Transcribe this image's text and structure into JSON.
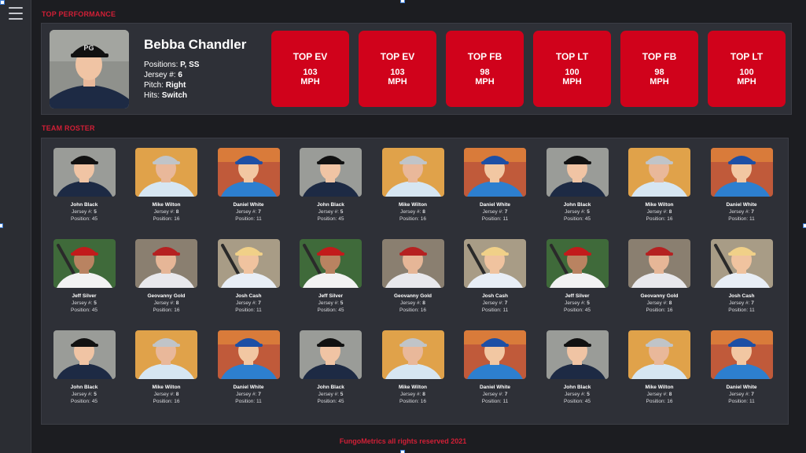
{
  "app": {
    "top_performance_label": "TOP PERFORMANCE",
    "team_roster_label": "TEAM ROSTER",
    "footer_text": "FungoMetrics all rights reserved 2021",
    "accent_color": "#d0021b",
    "menu_icon": "hamburger-menu-icon"
  },
  "profile": {
    "name": "Bebba Chandler",
    "positions_label": "Positions:",
    "positions": "P, SS",
    "jersey_label": "Jersey #:",
    "jersey": "6",
    "pitch_label": "Pitch:",
    "pitch": "Right",
    "hits_label": "Hits:",
    "hits": "Switch"
  },
  "stats": [
    {
      "label": "TOP EV",
      "value": "103",
      "unit": "MPH"
    },
    {
      "label": "TOP EV",
      "value": "103",
      "unit": "MPH"
    },
    {
      "label": "TOP FB",
      "value": "98",
      "unit": "MPH"
    },
    {
      "label": "TOP LT",
      "value": "100",
      "unit": "MPH"
    },
    {
      "label": "TOP FB",
      "value": "98",
      "unit": "MPH"
    },
    {
      "label": "TOP LT",
      "value": "100",
      "unit": "MPH"
    }
  ],
  "roster": [
    [
      {
        "name": "John Black",
        "jersey": "5",
        "position": "45",
        "avatar": "john"
      },
      {
        "name": "Mike Wilton",
        "jersey": "8",
        "position": "16",
        "avatar": "mike"
      },
      {
        "name": "Daniel White",
        "jersey": "7",
        "position": "11",
        "avatar": "daniel"
      },
      {
        "name": "John Black",
        "jersey": "5",
        "position": "45",
        "avatar": "john"
      },
      {
        "name": "Mike Wilton",
        "jersey": "8",
        "position": "16",
        "avatar": "mike"
      },
      {
        "name": "Daniel White",
        "jersey": "7",
        "position": "11",
        "avatar": "daniel"
      },
      {
        "name": "John Black",
        "jersey": "5",
        "position": "45",
        "avatar": "john"
      },
      {
        "name": "Mike Wilton",
        "jersey": "8",
        "position": "16",
        "avatar": "mike"
      },
      {
        "name": "Daniel White",
        "jersey": "7",
        "position": "11",
        "avatar": "daniel"
      }
    ],
    [
      {
        "name": "Jeff Silver",
        "jersey": "5",
        "position": "45",
        "avatar": "jeff"
      },
      {
        "name": "Geovanny Gold",
        "jersey": "8",
        "position": "16",
        "avatar": "geovanny"
      },
      {
        "name": "Josh Cash",
        "jersey": "7",
        "position": "11",
        "avatar": "josh"
      },
      {
        "name": "Jeff Silver",
        "jersey": "5",
        "position": "45",
        "avatar": "jeff"
      },
      {
        "name": "Geovanny Gold",
        "jersey": "8",
        "position": "16",
        "avatar": "geovanny"
      },
      {
        "name": "Josh Cash",
        "jersey": "7",
        "position": "11",
        "avatar": "josh"
      },
      {
        "name": "Jeff Silver",
        "jersey": "5",
        "position": "45",
        "avatar": "jeff"
      },
      {
        "name": "Geovanny Gold",
        "jersey": "8",
        "position": "16",
        "avatar": "geovanny"
      },
      {
        "name": "Josh Cash",
        "jersey": "7",
        "position": "11",
        "avatar": "josh"
      }
    ],
    [
      {
        "name": "John Black",
        "jersey": "5",
        "position": "45",
        "avatar": "john"
      },
      {
        "name": "Mike Wilton",
        "jersey": "8",
        "position": "16",
        "avatar": "mike"
      },
      {
        "name": "Daniel White",
        "jersey": "7",
        "position": "11",
        "avatar": "daniel"
      },
      {
        "name": "John Black",
        "jersey": "5",
        "position": "45",
        "avatar": "john"
      },
      {
        "name": "Mike Wilton",
        "jersey": "8",
        "position": "16",
        "avatar": "mike"
      },
      {
        "name": "Daniel White",
        "jersey": "7",
        "position": "11",
        "avatar": "daniel"
      },
      {
        "name": "John Black",
        "jersey": "5",
        "position": "45",
        "avatar": "john"
      },
      {
        "name": "Mike Wilton",
        "jersey": "8",
        "position": "16",
        "avatar": "mike"
      },
      {
        "name": "Daniel White",
        "jersey": "7",
        "position": "11",
        "avatar": "daniel"
      }
    ]
  ],
  "labels": {
    "jersey_label": "Jersey #:",
    "position_label": "Position:"
  }
}
